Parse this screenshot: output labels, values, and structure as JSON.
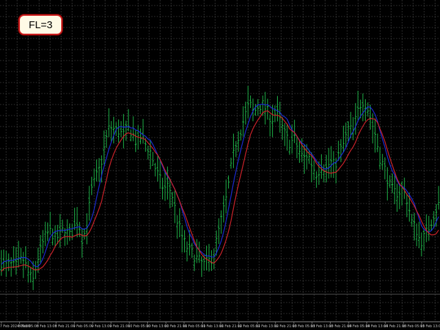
{
  "indicator_badge": {
    "label": "FL=3"
  },
  "colors": {
    "background": "#000000",
    "grid": "#3c3c3c",
    "bar": "#1fb84a",
    "line_fast": "#d0232b",
    "line_slow": "#1c2bd6"
  },
  "chart_data": {
    "type": "bar",
    "style": "OHLC bars with two moving-average lines",
    "grid": true,
    "x_tick_labels": [
      "7 Feb 2024 00:00",
      "8 Feb 05:00",
      "8 Feb 13:00",
      "8 Feb 21:00",
      "9 Feb 05:00",
      "9 Feb 13:00",
      "9 Feb 21:00",
      "10 Feb 05:00",
      "10 Feb 13:00",
      "10 Feb 21:00",
      "11 Feb 05:00",
      "11 Feb 13:00",
      "11 Feb 21:00",
      "12 Feb 05:00",
      "12 Feb 13:00",
      "12 Feb 21:00",
      "13 Feb 05:00",
      "13 Feb 13:00",
      "13 Feb 21:00",
      "14 Feb 05:00",
      "14 Feb 13:00",
      "14 Feb 21:00",
      "15 Feb 05:00",
      "15 Feb 13:00"
    ],
    "close_profile": [
      175,
      170,
      172,
      168,
      176,
      178,
      160,
      150,
      178,
      196,
      212,
      215,
      205,
      210,
      220,
      208,
      218,
      230,
      202,
      226,
      268,
      285,
      300,
      330,
      352,
      348,
      346,
      340,
      350,
      344,
      330,
      338,
      328,
      320,
      300,
      285,
      270,
      275,
      260,
      230,
      210,
      195,
      188,
      182,
      176,
      172,
      176,
      182,
      210,
      236,
      260,
      300,
      330,
      345,
      365,
      382,
      370,
      378,
      380,
      372,
      360,
      372,
      355,
      340,
      330,
      335,
      320,
      310,
      316,
      300,
      290,
      300,
      296,
      306,
      300,
      318,
      330,
      350,
      345,
      370,
      386,
      380,
      360,
      340,
      310,
      298,
      276,
      266,
      265,
      270,
      256,
      228,
      218,
      200,
      210,
      222,
      238,
      250
    ],
    "series": [
      {
        "kind": "bars",
        "values_ref": "close_profile"
      },
      {
        "kind": "fast_ma",
        "color_ref": "line_fast"
      },
      {
        "kind": "slow_ma",
        "color_ref": "line_slow"
      }
    ]
  }
}
